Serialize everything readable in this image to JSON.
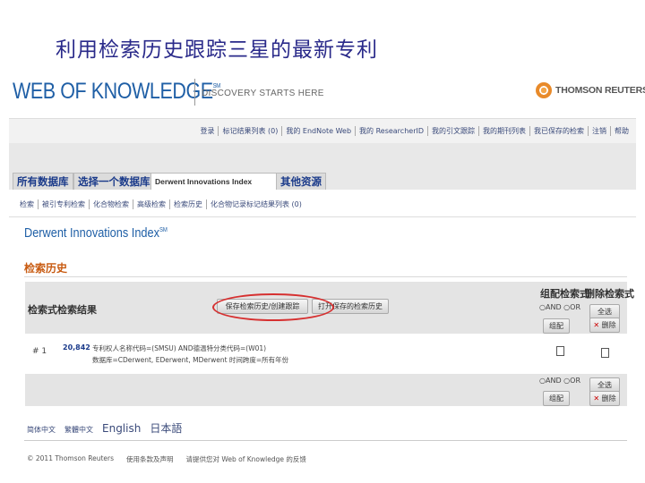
{
  "slide_title": "利用检索历史跟踪三星的最新专利",
  "header": {
    "logo_text": "WEB OF KNOWLEDGE",
    "logo_sm": "SM",
    "tagline": "DISCOVERY STARTS HERE",
    "brand_right": "THOMSON REUTERS"
  },
  "toplinks": [
    "登录",
    "标记结果列表 (0)",
    "我的 EndNote Web",
    "我的 ResearcherID",
    "我的引文跟踪",
    "我的期刊列表",
    "我已保存的检索",
    "注销",
    "帮助"
  ],
  "tabs": {
    "all_db": "所有数据库",
    "select_db": "选择一个数据库",
    "derwent": "Derwent Innovations Index",
    "other": "其他资源"
  },
  "subnav": [
    "检索",
    "被引专利检索",
    "化合物检索",
    "高级检索",
    "检索历史",
    "化合物记录标记结果列表 (0)"
  ],
  "db_title": "Derwent Innovations Index",
  "db_title_sm": "SM",
  "section_title": "检索历史",
  "history": {
    "col_set": "检索式",
    "col_results": "检索结果",
    "btn_save": "保存检索历史/创建跟踪",
    "btn_open": "打开保存的检索历史",
    "col_combine": "组配检索式",
    "col_delete": "删除检索式",
    "radio_and": "AND",
    "radio_or": "OR",
    "btn_combine": "组配",
    "btn_selectall": "全选",
    "btn_delete": "删除",
    "row": {
      "set": "# 1",
      "count": "20,842",
      "query": "专利权人名称代码=(SMSU) AND德温特分类代码=(W01)",
      "databases": "数据库=CDerwent, EDerwent, MDerwent 时间跨度=所有年份"
    }
  },
  "languages": {
    "simplified": "简体中文",
    "traditional": "繁體中文",
    "english": "English",
    "japanese": "日本語"
  },
  "footer": {
    "copyright": "© 2011 Thomson Reuters",
    "privacy": "使用条款及声明",
    "feedback": "请提供您对 Web of Knowledge 的反馈"
  }
}
